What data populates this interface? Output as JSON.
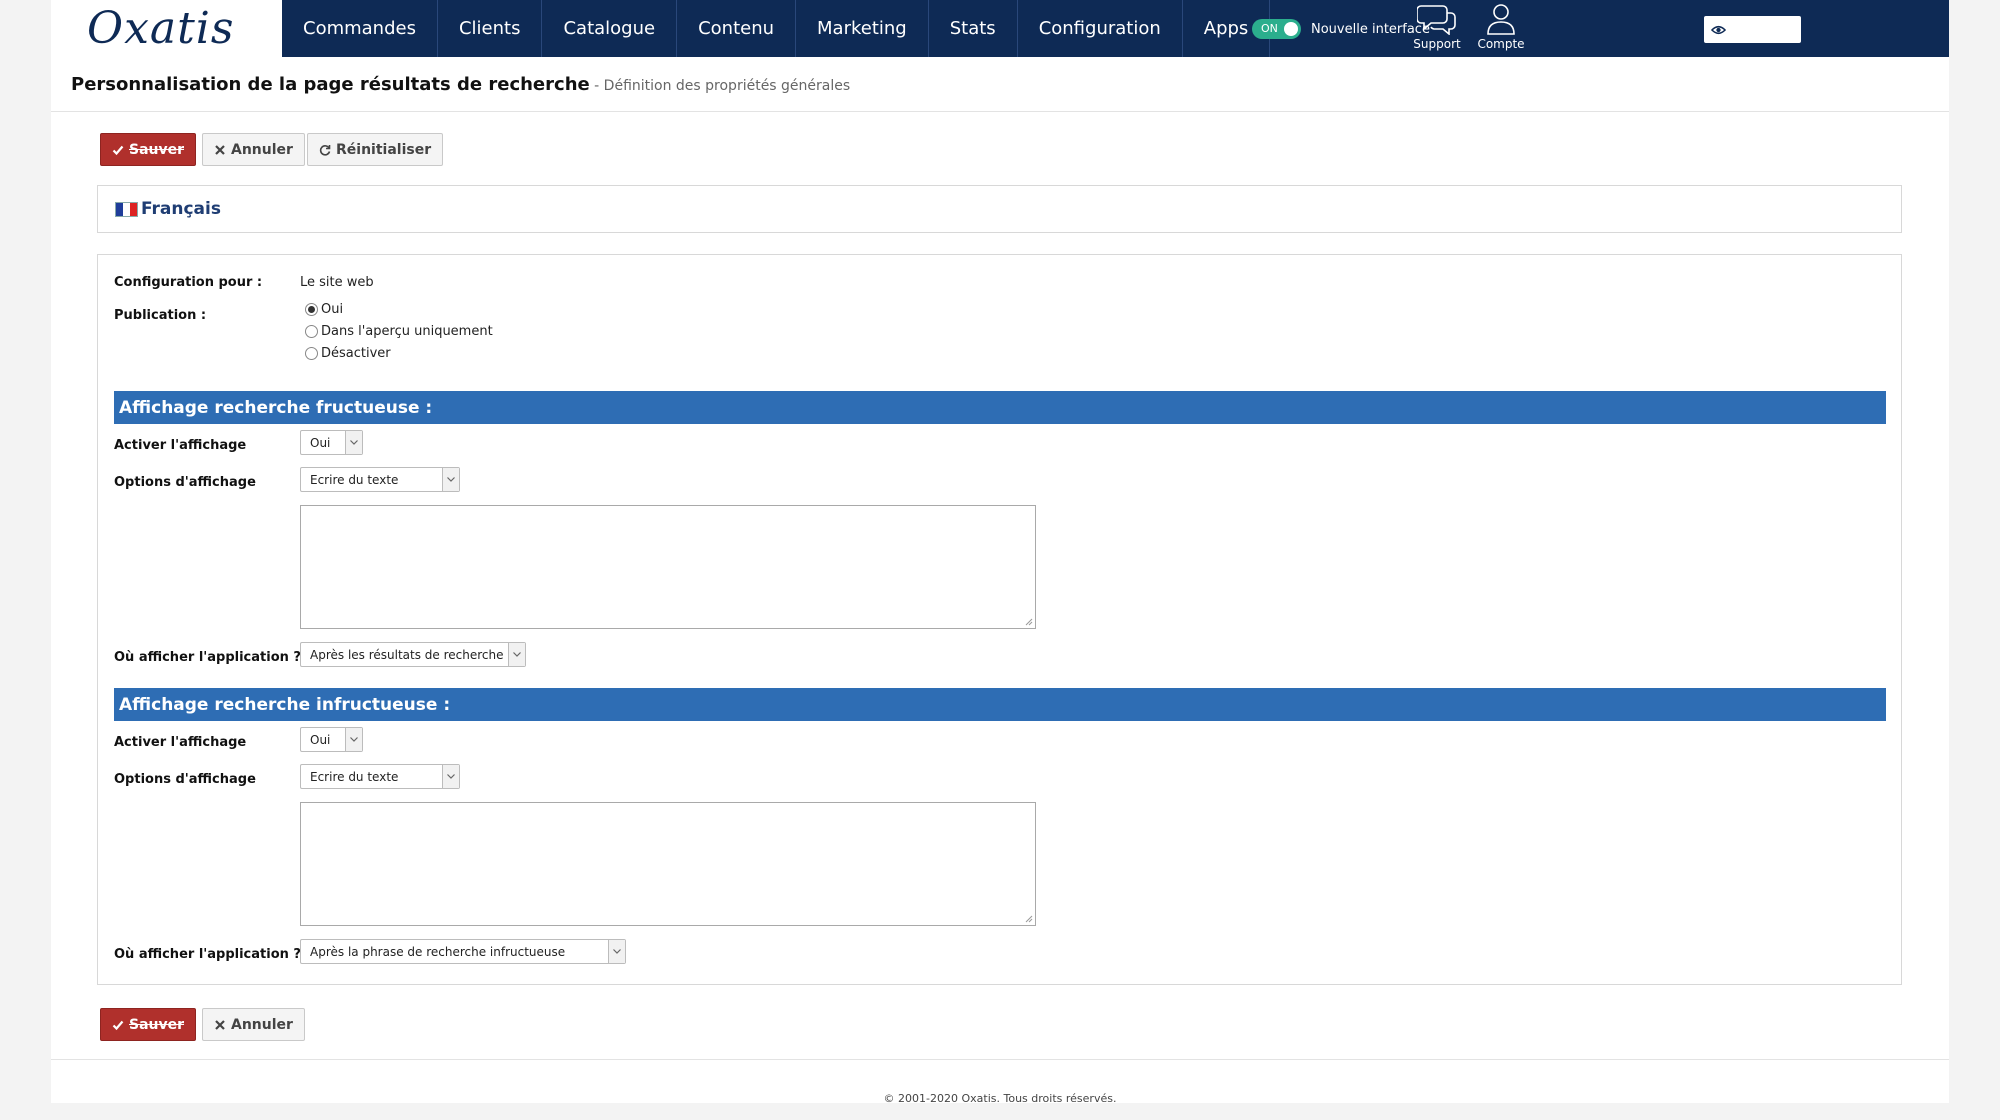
{
  "brand": {
    "logo_text": "Oxatis",
    "nav_color": "#0e2a55",
    "accent_red": "#b0302c",
    "section_blue": "#2e6db4"
  },
  "nav": {
    "items": [
      {
        "label": "Commandes"
      },
      {
        "label": "Clients"
      },
      {
        "label": "Catalogue"
      },
      {
        "label": "Contenu"
      },
      {
        "label": "Marketing"
      },
      {
        "label": "Stats"
      },
      {
        "label": "Configuration"
      },
      {
        "label": "Apps"
      }
    ],
    "toggle": {
      "state_label": "ON",
      "text": "Nouvelle interface"
    },
    "preview_icon": "eye-icon",
    "support": {
      "label": "Support",
      "icon": "chat-bubbles-icon"
    },
    "account": {
      "label": "Compte",
      "icon": "user-icon"
    }
  },
  "header": {
    "title": "Personnalisation de la page résultats de recherche",
    "subtitle": " - Définition des propriétés générales"
  },
  "toolbar": {
    "save_label": "Sauver",
    "cancel_label": "Annuler",
    "reset_label": "Réinitialiser"
  },
  "language": {
    "name": "Français",
    "flag": "fr-flag-icon"
  },
  "form": {
    "config_for_label": "Configuration pour :",
    "config_for_value": "Le site web",
    "publication_label": "Publication :",
    "publication_options": [
      {
        "label": "Oui",
        "checked": true
      },
      {
        "label": "Dans l'aperçu uniquement",
        "checked": false
      },
      {
        "label": "Désactiver",
        "checked": false
      }
    ],
    "sections": [
      {
        "title": "Affichage recherche fructueuse :",
        "enable_label": "Activer l'affichage",
        "enable_value": "Oui",
        "options_label": "Options d'affichage",
        "options_value": "Ecrire du texte",
        "text_value": "",
        "where_label": "Où afficher l'application ?",
        "where_value": "Après les résultats de recherche"
      },
      {
        "title": "Affichage recherche infructueuse :",
        "enable_label": "Activer l'affichage",
        "enable_value": "Oui",
        "options_label": "Options d'affichage",
        "options_value": "Ecrire du texte",
        "text_value": "",
        "where_label": "Où afficher l'application ?",
        "where_value": "Après la phrase de recherche infructueuse"
      }
    ]
  },
  "footer": {
    "copyright": "© 2001-2020 Oxatis. Tous droits réservés."
  }
}
